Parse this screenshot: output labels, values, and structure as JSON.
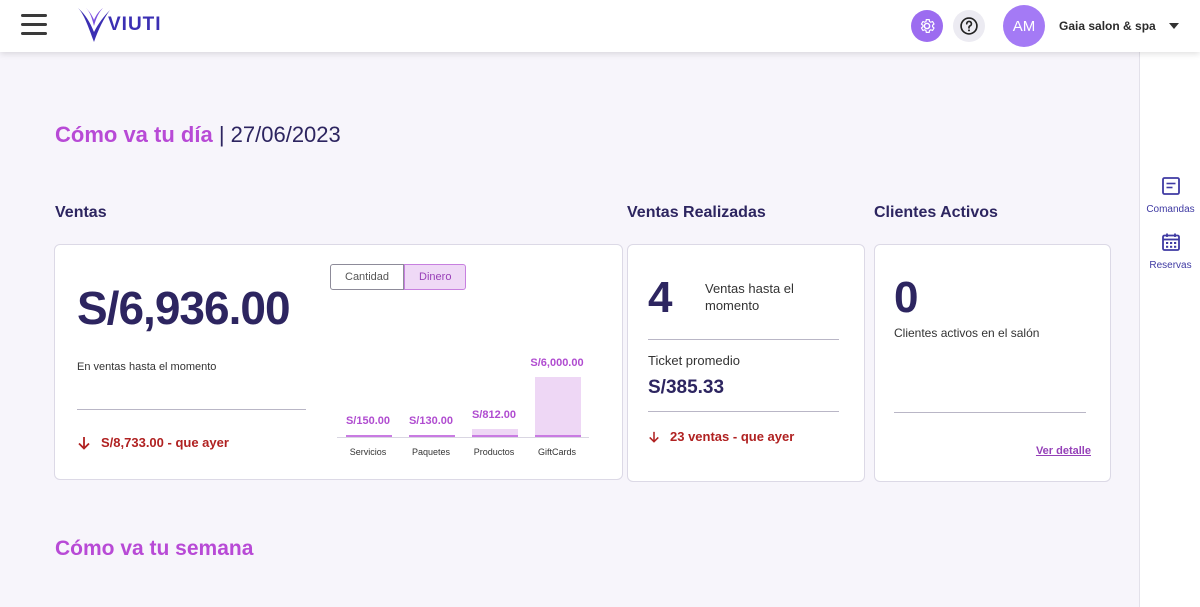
{
  "header": {
    "logo_text": "VIUTI",
    "avatar_initials": "AM",
    "account_name": "Gaia salon & spa",
    "menu_icon": "hamburger-icon",
    "settings_icon": "gear-icon",
    "help_icon": "help-icon"
  },
  "rightbar": {
    "items": [
      {
        "label": "Comandas",
        "icon": "note-icon"
      },
      {
        "label": "Reservas",
        "icon": "calendar-icon"
      }
    ]
  },
  "today": {
    "title": "Cómo va tu día",
    "separator": "|",
    "date": "27/06/2023"
  },
  "ventas": {
    "section_title": "Ventas",
    "amount": "S/6,936.00",
    "caption": "En ventas hasta el momento",
    "comparison": "S/8,733.00 - que ayer",
    "toggle": {
      "left": "Cantidad",
      "right": "Dinero",
      "selected": "Dinero"
    },
    "chart_data": {
      "type": "bar",
      "categories": [
        "Servicios",
        "Paquetes",
        "Productos",
        "GiftCards"
      ],
      "values": [
        150,
        130,
        812,
        6000
      ],
      "value_labels": [
        "S/150.00",
        "S/130.00",
        "S/812.00",
        "S/6,000.00"
      ],
      "title": "",
      "xlabel": "",
      "ylabel": ""
    }
  },
  "ventas_realizadas": {
    "section_title": "Ventas Realizadas",
    "count": "4",
    "count_caption": "Ventas hasta el momento",
    "ticket_label": "Ticket promedio",
    "ticket_value": "S/385.33",
    "comparison": "23 ventas - que ayer"
  },
  "clientes_activos": {
    "section_title": "Clientes Activos",
    "count": "0",
    "caption": "Clientes activos en el salón",
    "link": "Ver detalle"
  },
  "week": {
    "title": "Cómo va tu semana"
  },
  "colors": {
    "accent": "#b84ad6",
    "navy": "#2d2560",
    "negative": "#b02121",
    "bar_fill": "#eed7f5"
  }
}
